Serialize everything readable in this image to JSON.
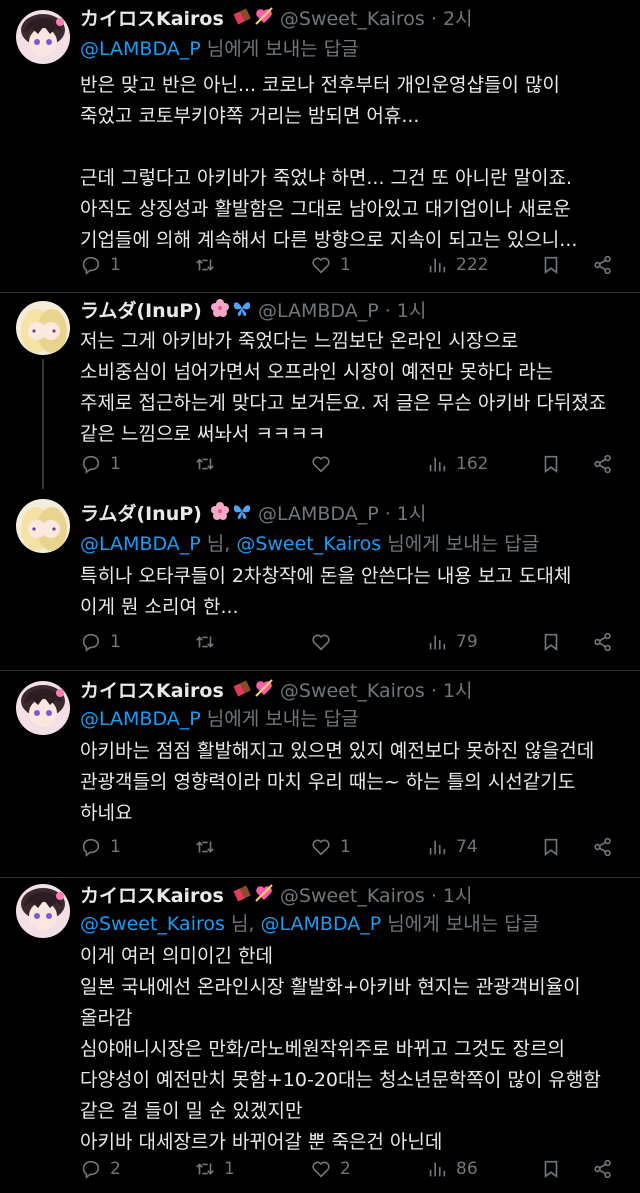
{
  "tweets": [
    {
      "name": "カイロスKairos",
      "handle": "@Sweet_Kairos",
      "sep": "·",
      "time": "2시",
      "replying_to": [
        {
          "text": "@LAMBDA_P"
        }
      ],
      "replying_sep": "",
      "replying_suffix": " 님에게 보내는 답글",
      "text": "반은 맞고 반은 아닌... 코로나 전후부터 개인운영샵들이 많이\n죽었고 코토부키야쪽 거리는 밤되면 어휴...\n\n근데 그렇다고 아키바가 죽었냐 하면... 그건 또 아니란 말이죠.\n아직도 상징성과 활발함은 그대로 남아있고 대기업이나 새로운\n기업들에 의해 계속해서 다른 방향으로 지속이 되고는 있으니...",
      "stats": {
        "replies": "1",
        "retweets": "",
        "likes": "1",
        "views": "222"
      }
    },
    {
      "name": "ラムダ(InuP)",
      "handle": "@LAMBDA_P",
      "sep": "·",
      "time": "1시",
      "replying_to": [],
      "text": "저는 그게 아키바가 죽었다는 느낌보단 온라인 시장으로\n소비중심이 넘어가면서 오프라인 시장이 예전만 못하다 라는\n주제로 접근하는게 맞다고 보거든요. 저 글은 무슨 아키바 다뒤졌죠\n같은 느낌으로 써놔서 ㅋㅋㅋㅋ",
      "stats": {
        "replies": "1",
        "retweets": "",
        "likes": "",
        "views": "162"
      }
    },
    {
      "name": "ラムダ(InuP)",
      "handle": "@LAMBDA_P",
      "sep": "·",
      "time": "1시",
      "replying_to": [
        {
          "text": "@LAMBDA_P"
        },
        {
          "text": "@Sweet_Kairos"
        }
      ],
      "replying_sep": " 님, ",
      "replying_suffix": " 님에게 보내는 답글",
      "text": "특히나 오타쿠들이 2차창작에 돈을 안쓴다는 내용 보고 도대체\n이게 뭔 소리여 한...",
      "stats": {
        "replies": "1",
        "retweets": "",
        "likes": "",
        "views": "79"
      }
    },
    {
      "name": "カイロスKairos",
      "handle": "@Sweet_Kairos",
      "sep": "·",
      "time": "1시",
      "replying_to": [
        {
          "text": "@LAMBDA_P"
        }
      ],
      "replying_sep": "",
      "replying_suffix": " 님에게 보내는 답글",
      "text": "아키바는 점점 활발해지고 있으면 있지 예전보다 못하진 않을건데\n관광객들의 영향력이라 마치 우리 때는~ 하는 틀의 시선같기도\n하네요",
      "stats": {
        "replies": "1",
        "retweets": "",
        "likes": "1",
        "views": "74"
      }
    },
    {
      "name": "カイロスKairos",
      "handle": "@Sweet_Kairos",
      "sep": "·",
      "time": "1시",
      "replying_to": [
        {
          "text": "@Sweet_Kairos"
        },
        {
          "text": "@LAMBDA_P"
        }
      ],
      "replying_sep": " 님, ",
      "replying_suffix": " 님에게 보내는 답글",
      "text": "이게 여러 의미이긴 한데\n일본 국내에선 온라인시장 활발화+아키바 현지는 관광객비율이\n올라감\n심야애니시장은 만화/라노베원작위주로 바뀌고 그것도 장르의\n다양성이 예전만치 못함+10-20대는 청소년문학쪽이 많이 유행함\n같은 걸 들이 밀 순 있겠지만\n아키바 대세장르가 바뀌어갈 뿐 죽은건 아닌데",
      "stats": {
        "replies": "2",
        "retweets": "1",
        "likes": "2",
        "views": "86"
      }
    }
  ],
  "colors": {
    "background": "#000000",
    "text": "#e7e9ea",
    "secondary": "#71767b",
    "link": "#1d9bf0",
    "divider": "#2f3336"
  },
  "icons": {
    "reply": "reply-icon",
    "retweet": "retweet-icon",
    "like": "like-icon",
    "views": "views-icon",
    "bookmark": "bookmark-icon",
    "share": "share-icon",
    "kairos_badges": [
      "chocolate-emoji",
      "heart-arrow-emoji"
    ],
    "lambda_badges": [
      "cherry-blossom-emoji",
      "butterfly-emoji"
    ]
  }
}
